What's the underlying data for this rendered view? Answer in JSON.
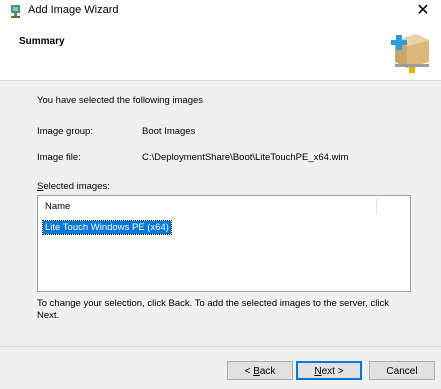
{
  "window": {
    "title": "Add Image Wizard",
    "close_glyph": "✕"
  },
  "header": {
    "heading": "Summary"
  },
  "summary": {
    "intro": "You have selected the following images",
    "image_group_label": "Image group:",
    "image_group_value": "Boot Images",
    "image_file_label": "Image file:",
    "image_file_value": "C:\\DeploymentShare\\Boot\\LiteTouchPE_x64.wim",
    "selected_images_label_rest": "elected images:",
    "selected_images_accel": "S"
  },
  "list": {
    "column_header": "Name",
    "items": [
      "Lite Touch Windows PE (x64)"
    ]
  },
  "instructions": "To change your selection, click Back. To add the selected images to the server, click Next.",
  "buttons": {
    "back_accel": "B",
    "back_rest": "ack",
    "back_prefix": "< ",
    "next_accel": "N",
    "next_rest": "ext >",
    "cancel": "Cancel"
  },
  "colors": {
    "selection": "#0078d7",
    "background": "#f0f0f0"
  }
}
